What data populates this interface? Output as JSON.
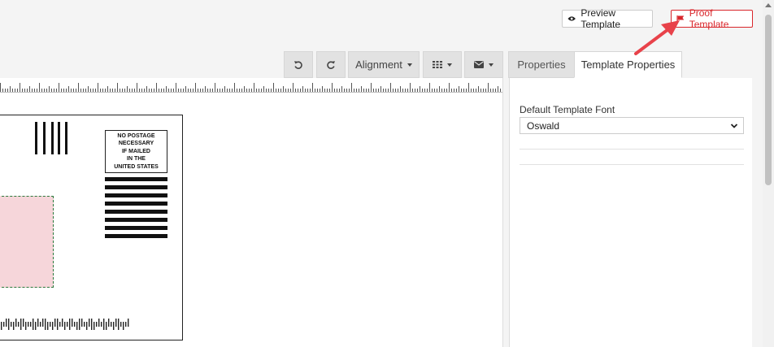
{
  "header": {
    "preview_button": {
      "label": "Preview Template",
      "icon": "eye-icon"
    },
    "proof_button": {
      "label": "Proof Template",
      "icon": "flag-icon",
      "color": "#d9262b"
    }
  },
  "toolbar": {
    "undo_icon": "undo-icon",
    "redo_icon": "redo-icon",
    "alignment_label": "Alignment",
    "grid_icon": "grid-icon",
    "mail_icon": "envelope-icon"
  },
  "tabs": [
    {
      "label": "Properties",
      "active": false
    },
    {
      "label": "Template Properties",
      "active": true
    }
  ],
  "panel": {
    "font_label": "Default Template Font",
    "font_value": "Oswald"
  },
  "mailpiece": {
    "postage_text": [
      "NO POSTAGE",
      "NECESSARY",
      "IF MAILED",
      "IN THE",
      "UNITED STATES"
    ],
    "address_zone_color": "#f6d6da",
    "address_zone_border": "#2b7a3d"
  },
  "annotation": {
    "arrow_color": "#e8424a"
  }
}
